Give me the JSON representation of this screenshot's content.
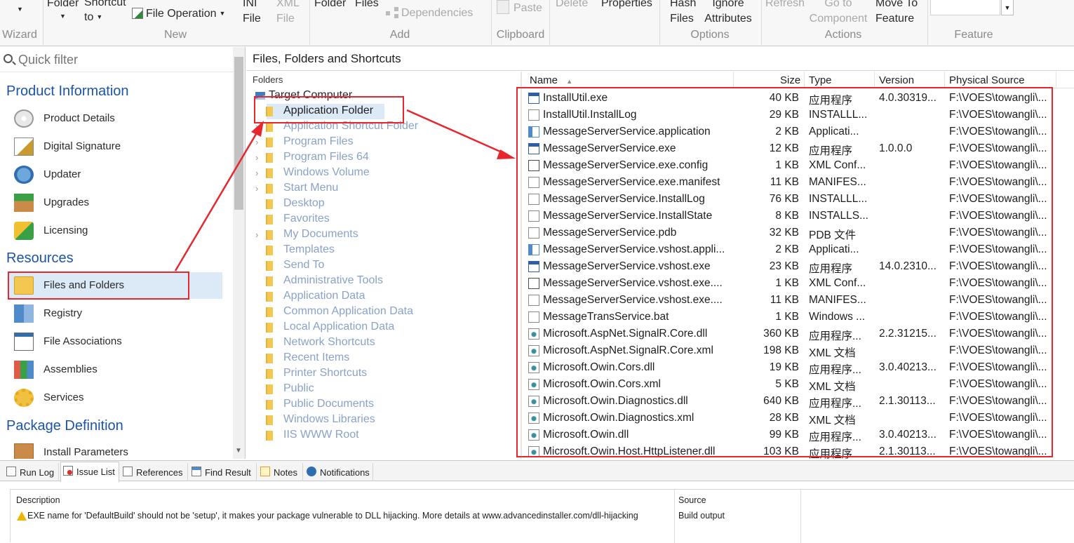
{
  "ribbon": {
    "buttons": [
      {
        "label": "Folder",
        "disabled": false
      },
      {
        "label": "Shortcut to",
        "disabled": false
      },
      {
        "label": "File Operation",
        "disabled": false
      },
      {
        "label": "INI File",
        "disabled": false
      },
      {
        "label": "XML File",
        "disabled": true
      },
      {
        "label": "Folder",
        "disabled": false
      },
      {
        "label": "Files",
        "disabled": false
      },
      {
        "label": "Dependencies",
        "disabled": true
      },
      {
        "label": "Paste",
        "disabled": true
      },
      {
        "label": "Delete",
        "disabled": true
      },
      {
        "label": "Properties",
        "disabled": false
      },
      {
        "label": "Hash Files",
        "disabled": false
      },
      {
        "label": "Ignore Attributes",
        "disabled": false
      },
      {
        "label": "Refresh",
        "disabled": true
      },
      {
        "label": "Go to Component",
        "disabled": true
      },
      {
        "label": "Move To Feature",
        "disabled": false
      }
    ],
    "groups": [
      "Wizard",
      "New",
      "Add",
      "Clipboard",
      "Options",
      "Actions",
      "Feature"
    ]
  },
  "leftnav": {
    "filter_placeholder": "Quick filter",
    "sections": [
      {
        "title": "Product Information",
        "items": [
          "Product Details",
          "Digital Signature",
          "Updater",
          "Upgrades",
          "Licensing"
        ]
      },
      {
        "title": "Resources",
        "items": [
          "Files and Folders",
          "Registry",
          "File Associations",
          "Assemblies",
          "Services"
        ]
      },
      {
        "title": "Package Definition",
        "items": [
          "Install Parameters"
        ]
      }
    ],
    "selected": "Files and Folders"
  },
  "main": {
    "title": "Files, Folders and Shortcuts",
    "folders_header": "Folders",
    "tree": {
      "root": "Target Computer",
      "selected": "Application Folder",
      "items": [
        {
          "label": "Application Folder",
          "expandable": false
        },
        {
          "label": "Application Shortcut Folder",
          "expandable": true
        },
        {
          "label": "Program Files",
          "expandable": true
        },
        {
          "label": "Program Files 64",
          "expandable": true
        },
        {
          "label": "Windows Volume",
          "expandable": true
        },
        {
          "label": "Start Menu",
          "expandable": true
        },
        {
          "label": "Desktop",
          "expandable": false
        },
        {
          "label": "Favorites",
          "expandable": false
        },
        {
          "label": "My Documents",
          "expandable": true
        },
        {
          "label": "Templates",
          "expandable": false
        },
        {
          "label": "Send To",
          "expandable": false
        },
        {
          "label": "Administrative Tools",
          "expandable": false
        },
        {
          "label": "Application Data",
          "expandable": false
        },
        {
          "label": "Common Application Data",
          "expandable": false
        },
        {
          "label": "Local Application Data",
          "expandable": false
        },
        {
          "label": "Network Shortcuts",
          "expandable": false
        },
        {
          "label": "Recent Items",
          "expandable": false
        },
        {
          "label": "Printer Shortcuts",
          "expandable": false
        },
        {
          "label": "Public",
          "expandable": false
        },
        {
          "label": "Public Documents",
          "expandable": false
        },
        {
          "label": "Windows Libraries",
          "expandable": false
        },
        {
          "label": "IIS WWW Root",
          "expandable": false
        }
      ]
    },
    "columns": [
      "Name",
      "Size",
      "Type",
      "Version",
      "Physical Source"
    ],
    "files": [
      {
        "name": "InstallUtil.exe",
        "size": "40 KB",
        "type": "应用程序",
        "version": "4.0.30319...",
        "source": "F:\\VOES\\towangli\\...",
        "icon": "exe"
      },
      {
        "name": "InstallUtil.InstallLog",
        "size": "29 KB",
        "type": "INSTALLL...",
        "version": "",
        "source": "F:\\VOES\\towangli\\...",
        "icon": "doc"
      },
      {
        "name": "MessageServerService.application",
        "size": "2 KB",
        "type": "Applicati...",
        "version": "",
        "source": "F:\\VOES\\towangli\\...",
        "icon": "app"
      },
      {
        "name": "MessageServerService.exe",
        "size": "12 KB",
        "type": "应用程序",
        "version": "1.0.0.0",
        "source": "F:\\VOES\\towangli\\...",
        "icon": "exe"
      },
      {
        "name": "MessageServerService.exe.config",
        "size": "1 KB",
        "type": "XML Conf...",
        "version": "",
        "source": "F:\\VOES\\towangli\\...",
        "icon": "xml"
      },
      {
        "name": "MessageServerService.exe.manifest",
        "size": "11 KB",
        "type": "MANIFES...",
        "version": "",
        "source": "F:\\VOES\\towangli\\...",
        "icon": "doc"
      },
      {
        "name": "MessageServerService.InstallLog",
        "size": "76 KB",
        "type": "INSTALLL...",
        "version": "",
        "source": "F:\\VOES\\towangli\\...",
        "icon": "doc"
      },
      {
        "name": "MessageServerService.InstallState",
        "size": "8 KB",
        "type": "INSTALLS...",
        "version": "",
        "source": "F:\\VOES\\towangli\\...",
        "icon": "doc"
      },
      {
        "name": "MessageServerService.pdb",
        "size": "32 KB",
        "type": "PDB 文件",
        "version": "",
        "source": "F:\\VOES\\towangli\\...",
        "icon": "doc"
      },
      {
        "name": "MessageServerService.vshost.appli...",
        "size": "2 KB",
        "type": "Applicati...",
        "version": "",
        "source": "F:\\VOES\\towangli\\...",
        "icon": "app"
      },
      {
        "name": "MessageServerService.vshost.exe",
        "size": "23 KB",
        "type": "应用程序",
        "version": "14.0.2310...",
        "source": "F:\\VOES\\towangli\\...",
        "icon": "exe"
      },
      {
        "name": "MessageServerService.vshost.exe....",
        "size": "1 KB",
        "type": "XML Conf...",
        "version": "",
        "source": "F:\\VOES\\towangli\\...",
        "icon": "xml"
      },
      {
        "name": "MessageServerService.vshost.exe....",
        "size": "11 KB",
        "type": "MANIFES...",
        "version": "",
        "source": "F:\\VOES\\towangli\\...",
        "icon": "doc"
      },
      {
        "name": "MessageTransService.bat",
        "size": "1 KB",
        "type": "Windows ...",
        "version": "",
        "source": "F:\\VOES\\towangli\\...",
        "icon": "doc"
      },
      {
        "name": "Microsoft.AspNet.SignalR.Core.dll",
        "size": "360 KB",
        "type": "应用程序...",
        "version": "2.2.31215...",
        "source": "F:\\VOES\\towangli\\...",
        "icon": "dll"
      },
      {
        "name": "Microsoft.AspNet.SignalR.Core.xml",
        "size": "198 KB",
        "type": "XML 文档",
        "version": "",
        "source": "F:\\VOES\\towangli\\...",
        "icon": "dll"
      },
      {
        "name": "Microsoft.Owin.Cors.dll",
        "size": "19 KB",
        "type": "应用程序...",
        "version": "3.0.40213...",
        "source": "F:\\VOES\\towangli\\...",
        "icon": "dll"
      },
      {
        "name": "Microsoft.Owin.Cors.xml",
        "size": "5 KB",
        "type": "XML 文档",
        "version": "",
        "source": "F:\\VOES\\towangli\\...",
        "icon": "dll"
      },
      {
        "name": "Microsoft.Owin.Diagnostics.dll",
        "size": "640 KB",
        "type": "应用程序...",
        "version": "2.1.30113...",
        "source": "F:\\VOES\\towangli\\...",
        "icon": "dll"
      },
      {
        "name": "Microsoft.Owin.Diagnostics.xml",
        "size": "28 KB",
        "type": "XML 文档",
        "version": "",
        "source": "F:\\VOES\\towangli\\...",
        "icon": "dll"
      },
      {
        "name": "Microsoft.Owin.dll",
        "size": "99 KB",
        "type": "应用程序...",
        "version": "3.0.40213...",
        "source": "F:\\VOES\\towangli\\...",
        "icon": "dll"
      },
      {
        "name": "Microsoft.Owin.Host.HttpListener.dll",
        "size": "103 KB",
        "type": "应用程序...",
        "version": "2.1.30113...",
        "source": "F:\\VOES\\towangli\\...",
        "icon": "dll"
      }
    ]
  },
  "bottom": {
    "tabs": [
      "Run Log",
      "Issue List",
      "References",
      "Find Result",
      "Notes",
      "Notifications"
    ],
    "active_tab": "Issue List",
    "columns": [
      "Description",
      "Source"
    ],
    "issues": [
      {
        "description": "EXE name for 'DefaultBuild' should not be 'setup', it makes your package vulnerable to DLL hijacking. More details at www.advancedinstaller.com/dll-hijacking",
        "source": "Build output"
      }
    ]
  },
  "colors": {
    "annotation": "#e8262e",
    "section_title": "#1c55a6",
    "selection": "#dceaf8",
    "tree_text": "#8aa2c8"
  }
}
